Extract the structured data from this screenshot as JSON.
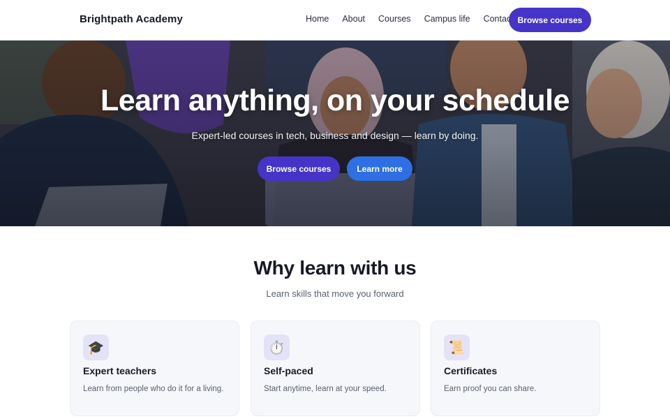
{
  "header": {
    "brand": "Brightpath Academy",
    "nav": [
      "Home",
      "About",
      "Courses",
      "Campus life",
      "Contact"
    ],
    "cta": "Browse courses"
  },
  "hero": {
    "title": "Learn anything, on your schedule",
    "subtitle": "Expert-led courses in tech, business and design — learn by doing.",
    "primary_button": "Browse courses",
    "secondary_button": "Learn more",
    "image": "group-of-students-studying-with-laptops"
  },
  "features": {
    "title": "Why learn with us",
    "subtitle": "Learn skills that move you forward",
    "cards": [
      {
        "icon": "graduation-cap-icon",
        "glyph": "🎓",
        "title": "Expert teachers",
        "text": "Learn from people who do it for a living."
      },
      {
        "icon": "stopwatch-icon",
        "glyph": "⏱️",
        "title": "Self-paced",
        "text": "Start anytime, learn at your speed."
      },
      {
        "icon": "scroll-icon",
        "glyph": "📜",
        "title": "Certificates",
        "text": "Earn proof you can share."
      }
    ]
  },
  "colors": {
    "primary": "#4634c8",
    "secondary": "#2f6fe4",
    "card_bg": "#f6f7fa",
    "icon_bg": "#e4e2f7"
  }
}
